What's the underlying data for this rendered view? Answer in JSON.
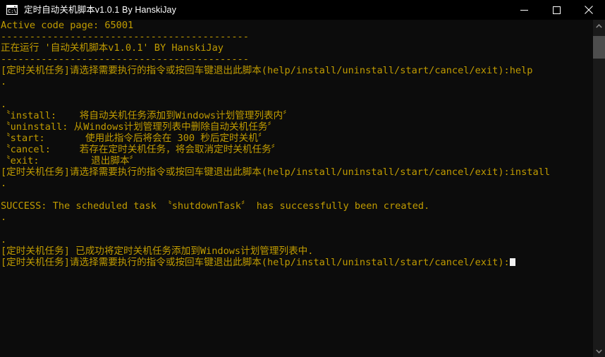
{
  "window": {
    "title": "定时自动关机脚本v1.0.1 By HanskiJay",
    "icon": "console-cmd-icon",
    "titlebar_bg": "#000000",
    "title_color": "#ffffff",
    "buttons": [
      {
        "name": "minimize",
        "glyph": "minimize-icon"
      },
      {
        "name": "maximize",
        "glyph": "maximize-icon"
      },
      {
        "name": "close",
        "glyph": "close-icon"
      }
    ]
  },
  "console": {
    "background": "#0c0c0c",
    "text_color": "#c19c00",
    "cursor_color": "#f2f2f2",
    "lines": [
      "Active code page: 65001",
      "-------------------------------------------",
      "正在运行 '自动关机脚本v1.0.1' BY HanskiJay",
      "-------------------------------------------",
      "[定时关机任务]请选择需要执行的指令或按回车键退出此脚本(help/install/uninstall/start/cancel/exit):help",
      ".",
      "",
      ".",
      "〝install:    将自动关机任务添加到Windows计划管理列表内〞",
      "〝uninstall: 从Windows计划管理列表中删除自动关机任务〞",
      "〝start:       使用此指令后将会在 300 秒后定时关机〞",
      "〝cancel:     若存在定时关机任务，将会取消定时关机任务〞",
      "〝exit:         退出脚本〞",
      "[定时关机任务]请选择需要执行的指令或按回车键退出此脚本(help/install/uninstall/start/cancel/exit):install",
      ".",
      "",
      "SUCCESS: The scheduled task 〝shutdownTask〞 has successfully been created.",
      ".",
      "",
      ".",
      "[定时关机任务] 已成功将定时关机任务添加到Windows计划管理列表中.",
      "[定时关机任务]请选择需要执行的指令或按回车键退出此脚本(help/install/uninstall/start/cancel/exit):"
    ],
    "cursor_line_index": 21
  },
  "scrollbar": {
    "track_color": "#1a1a1a",
    "thumb_color": "#4d4d4d",
    "up_arrow": "chevron-up-icon",
    "down_arrow": "chevron-down-icon"
  }
}
